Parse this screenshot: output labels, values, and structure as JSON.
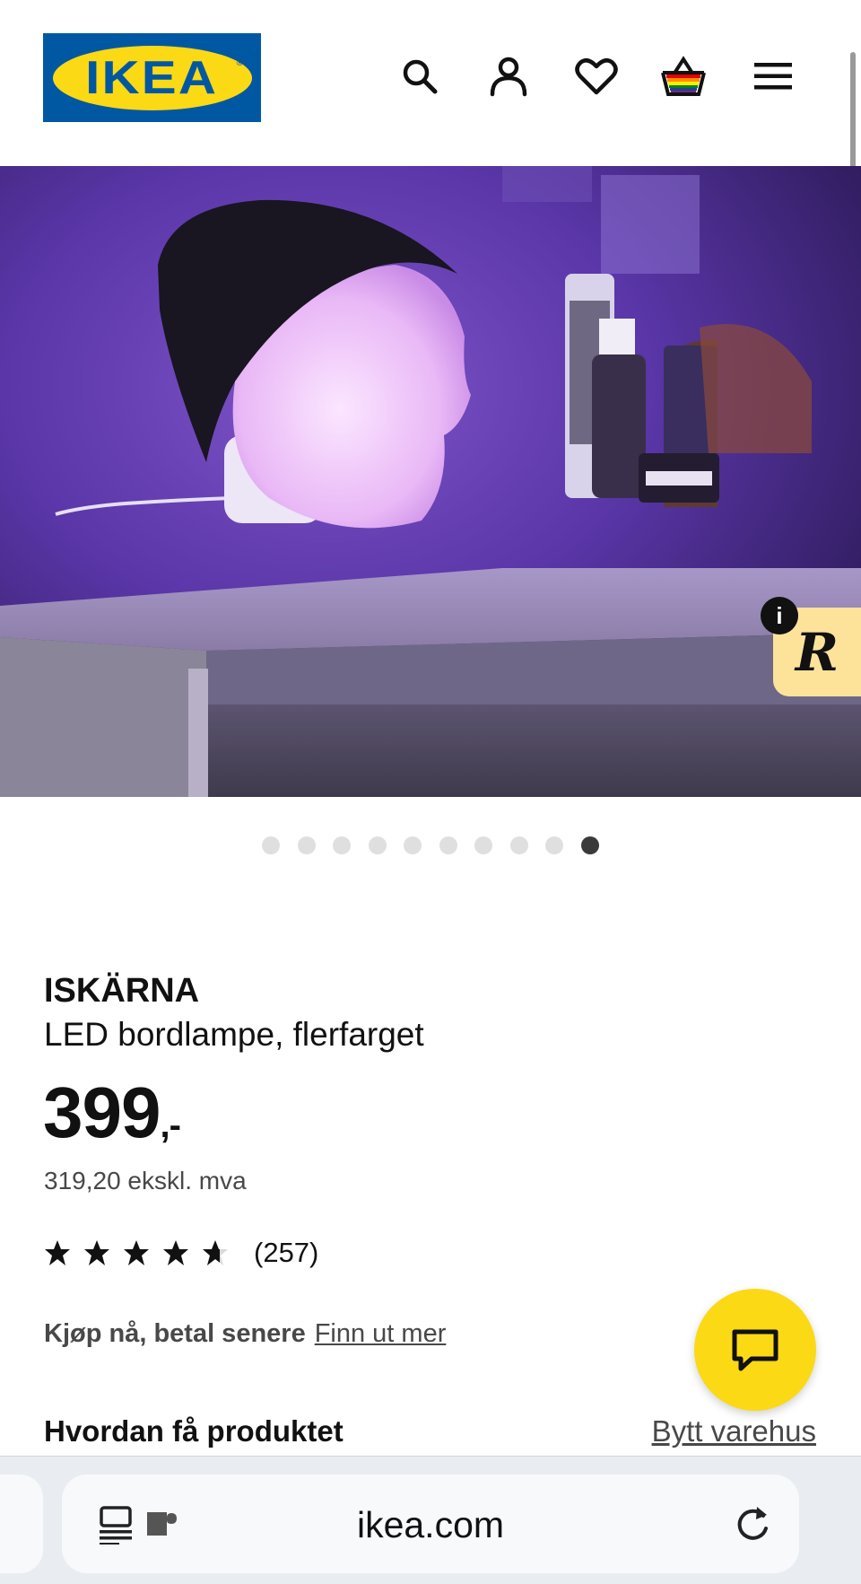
{
  "header": {
    "logo_text": "IKEA",
    "icons": [
      "search-icon",
      "account-icon",
      "heart-icon",
      "basket-icon",
      "menu-icon"
    ]
  },
  "gallery": {
    "image_count": 10,
    "active_index": 9
  },
  "product": {
    "name": "ISKÄRNA",
    "description": "LED bordlampe, flerfarget",
    "price": "399",
    "price_suffix": ",-",
    "price_excl_vat": "319,20 ekskl. mva",
    "rating": 4.5,
    "review_count": "(257)"
  },
  "financing": {
    "label": "Kjøp nå, betal senere",
    "link": "Finn ut mer"
  },
  "delivery": {
    "title": "Hvordan få produktet",
    "change_store": "Bytt varehus"
  },
  "browser": {
    "url": "ikea.com"
  },
  "colors": {
    "ikea_blue": "#0058a3",
    "ikea_yellow": "#fbd914"
  }
}
